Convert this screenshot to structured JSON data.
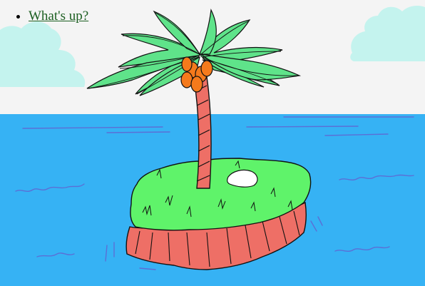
{
  "nav": {
    "items": [
      {
        "label": "What's up?"
      }
    ]
  },
  "scene": {
    "sky_color": "#f4f4f4",
    "cloud_color": "#c4f3ee",
    "sea_color": "#36b2f4",
    "wave_color": "#5b6fd6",
    "grass_color": "#5ff36a",
    "cliff_color": "#ee6f66",
    "trunk_color": "#ee6f66",
    "leaf_color": "#5fe38a",
    "coconut_color": "#f57a1c",
    "rock_color": "#ffffff",
    "outline_color": "#111111"
  }
}
